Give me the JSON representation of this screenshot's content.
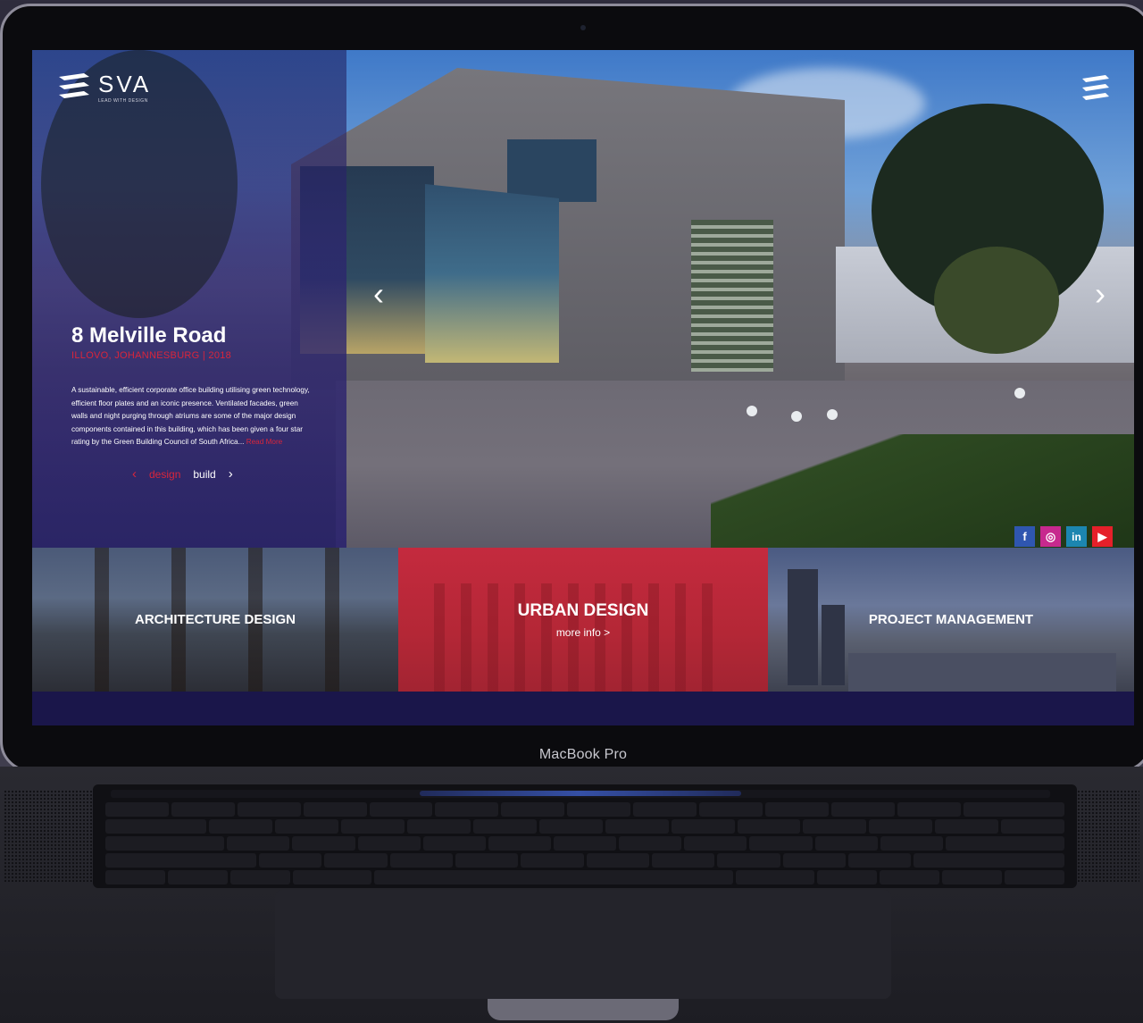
{
  "device": {
    "brand_label": "MacBook Pro"
  },
  "site": {
    "logo": {
      "text": "SVA",
      "tagline": "LEAD WITH DESIGN"
    },
    "hero": {
      "project_title": "8 Melville Road",
      "location": "ILLOVO, JOHANNESBURG | 2018",
      "description": "A sustainable, efficient corporate office building utilising green technology, efficient floor plates and an iconic presence. Ventilated facades, green walls and night purging through atriums are some of the major design components contained in this building, which has been given a four star rating by the Green Building Council of South Africa...",
      "read_more_label": "Read More",
      "tabs": [
        {
          "label": "design",
          "active": true
        },
        {
          "label": "build",
          "active": false
        }
      ],
      "prev_arrow": "‹",
      "next_arrow": "›",
      "tab_prev": "‹",
      "tab_next": "›"
    },
    "socials": [
      {
        "name": "facebook",
        "glyph": "f",
        "color": "#2f56b0"
      },
      {
        "name": "instagram",
        "glyph": "◎",
        "color": "#c7298e"
      },
      {
        "name": "linkedin",
        "glyph": "in",
        "color": "#1c86b0"
      },
      {
        "name": "youtube",
        "glyph": "▶",
        "color": "#e5202a"
      }
    ],
    "services": [
      {
        "title": "ARCHITECTURE DESIGN"
      },
      {
        "title": "URBAN DESIGN",
        "more_info": "more info >"
      },
      {
        "title": "PROJECT MANAGEMENT"
      }
    ],
    "colors": {
      "accent": "#d9253b",
      "overlay": "#2c2470",
      "urban_panel": "#c42a3e",
      "footer_band": "#1a164a"
    },
    "icons": {
      "logo": "stacked-chevrons-icon",
      "menu": "stacked-chevrons-menu-icon"
    }
  }
}
